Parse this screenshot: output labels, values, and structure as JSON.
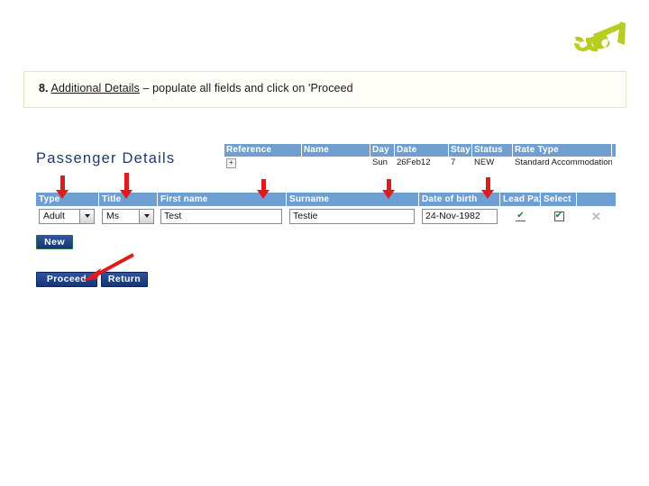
{
  "slide": {
    "instruction": {
      "number": "8.",
      "link_text": "Additional Details",
      "rest_text": " – populate all fields and click on 'Proceed"
    },
    "logo_name": "company-logo"
  },
  "app": {
    "page_title": "Passenger Details",
    "summary": {
      "headers": [
        "Reference",
        "Name",
        "Day",
        "Date",
        "Stay",
        "Status",
        "Rate Type"
      ],
      "row": {
        "reference": "+",
        "name": "",
        "day": "Sun",
        "date": "26Feb12",
        "stay": "7",
        "status": "NEW",
        "rate_type": "Standard Accommodation"
      }
    },
    "grid": {
      "headers": [
        "Type",
        "Title",
        "First name",
        "Surname",
        "Date of birth",
        "Lead Pax",
        "Select",
        ""
      ],
      "row": {
        "type": "Adult",
        "title": "Ms",
        "first_name": "Test",
        "surname": "Testie",
        "date_of_birth": "24-Nov-1982",
        "lead_pax_checked": "✔",
        "select_checked": "✔",
        "delete_icon": "✕"
      }
    },
    "buttons": {
      "new": "New",
      "proceed": "Proceed",
      "return": "Return"
    }
  },
  "colors": {
    "header_blue": "#6f9fd0",
    "button_blue": "#17347a",
    "title_blue": "#1f3a68",
    "annotation_red": "#e01b1b",
    "logo_green": "#b8cc22",
    "callout_bg": "#fffef8",
    "callout_border": "#e8e0c8"
  }
}
